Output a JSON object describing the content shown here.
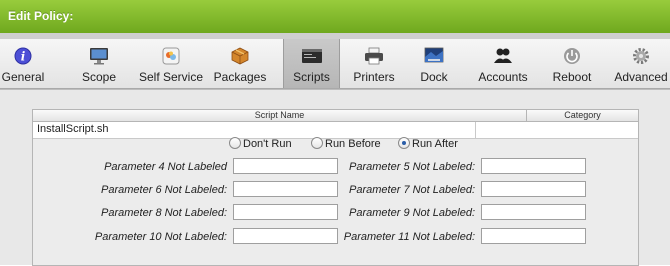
{
  "header": {
    "title": "Edit Policy:"
  },
  "tabs": [
    {
      "id": "general",
      "label": "General",
      "icon": "info-icon"
    },
    {
      "id": "scope",
      "label": "Scope",
      "icon": "monitor-icon"
    },
    {
      "id": "self_service",
      "label": "Self Service",
      "icon": "self-service-icon"
    },
    {
      "id": "packages",
      "label": "Packages",
      "icon": "package-icon"
    },
    {
      "id": "scripts",
      "label": "Scripts",
      "icon": "script-icon",
      "active": true
    },
    {
      "id": "printers",
      "label": "Printers",
      "icon": "printer-icon"
    },
    {
      "id": "dock",
      "label": "Dock",
      "icon": "dock-icon"
    },
    {
      "id": "accounts",
      "label": "Accounts",
      "icon": "accounts-icon"
    },
    {
      "id": "reboot",
      "label": "Reboot",
      "icon": "power-icon"
    },
    {
      "id": "advanced",
      "label": "Advanced",
      "icon": "gear-icon"
    }
  ],
  "table": {
    "col_script_name": "Script Name",
    "col_category": "Category",
    "row": {
      "name": "InstallScript.sh",
      "category": ""
    }
  },
  "run_options": {
    "dont_run": "Don't Run",
    "run_before": "Run Before",
    "run_after": "Run After",
    "selected": "run_after"
  },
  "parameters": {
    "p4": {
      "label": "Parameter 4 Not Labeled",
      "value": ""
    },
    "p5": {
      "label": "Parameter 5 Not Labeled:",
      "value": ""
    },
    "p6": {
      "label": "Parameter 6 Not Labeled:",
      "value": ""
    },
    "p7": {
      "label": "Parameter 7 Not Labeled:",
      "value": ""
    },
    "p8": {
      "label": "Parameter 8 Not Labeled:",
      "value": ""
    },
    "p9": {
      "label": "Parameter 9 Not Labeled:",
      "value": ""
    },
    "p10": {
      "label": "Parameter 10 Not Labeled:",
      "value": ""
    },
    "p11": {
      "label": "Parameter 11 Not Labeled:",
      "value": ""
    }
  },
  "colors": {
    "header_green": "#7fb52a",
    "radio_selected": "#2b5ea8"
  }
}
